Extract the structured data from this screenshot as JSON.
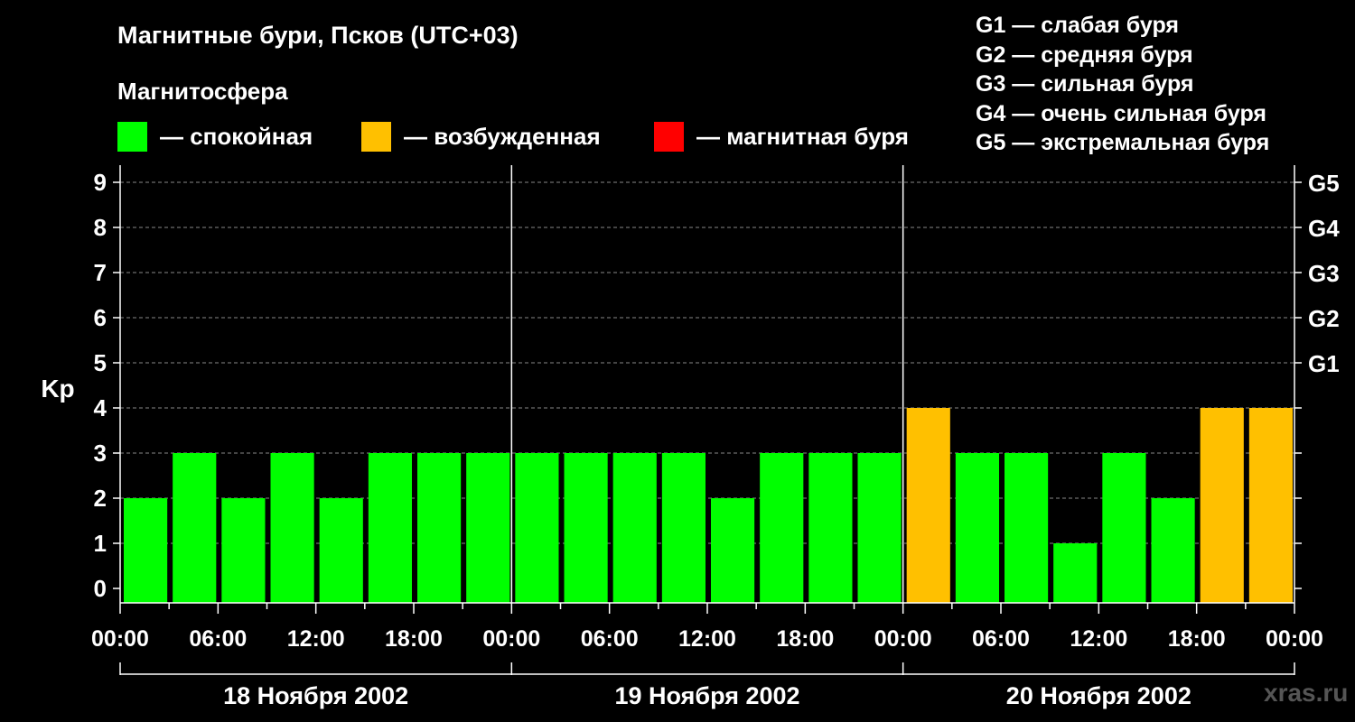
{
  "title": "Магнитные бури, Псков (UTC+03)",
  "magnetosphere": {
    "heading": "Магнитосфера",
    "items": [
      {
        "label": "— спокойная",
        "color": "#00ff00"
      },
      {
        "label": "— возбужденная",
        "color": "#ffc000"
      },
      {
        "label": "— магнитная буря",
        "color": "#ff0000"
      }
    ]
  },
  "storm_scale": [
    "G1 — слабая буря",
    "G2 — средняя буря",
    "G3 — сильная буря",
    "G4 — очень сильная буря",
    "G5 — экстремальная буря"
  ],
  "watermark": "xras.ru",
  "chart_data": {
    "type": "bar",
    "ylabel": "Kp",
    "ylim": [
      0,
      9
    ],
    "yticks": [
      "0",
      "1",
      "2",
      "3",
      "4",
      "5",
      "6",
      "7",
      "8",
      "9"
    ],
    "right_ticks": [
      {
        "kp": 5,
        "label": "G1"
      },
      {
        "kp": 6,
        "label": "G2"
      },
      {
        "kp": 7,
        "label": "G3"
      },
      {
        "kp": 8,
        "label": "G4"
      },
      {
        "kp": 9,
        "label": "G5"
      }
    ],
    "xtick_labels": [
      "00:00",
      "06:00",
      "12:00",
      "18:00",
      "00:00",
      "06:00",
      "12:00",
      "18:00",
      "00:00",
      "06:00",
      "12:00",
      "18:00",
      "00:00"
    ],
    "days": [
      "18 Ноября 2002",
      "19 Ноября 2002",
      "20 Ноября 2002"
    ],
    "values": [
      2,
      3,
      2,
      3,
      2,
      3,
      3,
      3,
      3,
      3,
      3,
      3,
      2,
      3,
      3,
      3,
      4,
      3,
      3,
      1,
      3,
      2,
      4,
      4
    ],
    "colors": {
      "quiet": "#00ff00",
      "active": "#ffc000",
      "storm": "#ff0000"
    },
    "grid": true
  }
}
